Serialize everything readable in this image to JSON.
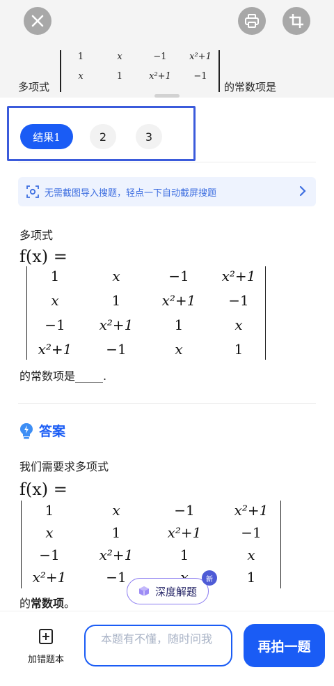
{
  "photo": {
    "left_text": "多项式",
    "right_text": "的常数项是",
    "matrix_rows": [
      [
        "1",
        "x",
        "−1",
        "x²+1"
      ],
      [
        "x",
        "1",
        "x²+1",
        "−1"
      ]
    ]
  },
  "toolbar": {
    "close_icon": "close-icon",
    "print_icon": "printer-icon",
    "crop_icon": "crop-icon"
  },
  "tabs": {
    "items": [
      {
        "label": "结果1",
        "active": true
      },
      {
        "label": "2",
        "active": false
      },
      {
        "label": "3",
        "active": false
      }
    ]
  },
  "banner": {
    "text": "无需截图导入搜题，轻点一下自动截屏搜题"
  },
  "question": {
    "intro": "多项式",
    "fx": "f(x) =",
    "matrix": [
      [
        "1",
        "x",
        "−1",
        "x²+1"
      ],
      [
        "x",
        "1",
        "x²+1",
        "−1"
      ],
      [
        "−1",
        "x²+1",
        "1",
        "x"
      ],
      [
        "x²+1",
        "−1",
        "x",
        "1"
      ]
    ],
    "tail": "的常数项是_____."
  },
  "answer": {
    "title": "答案",
    "intro": "我们需要求多项式",
    "fx": "f(x) =",
    "matrix": [
      [
        "1",
        "x",
        "−1",
        "x²+1"
      ],
      [
        "x",
        "1",
        "x²+1",
        "−1"
      ],
      [
        "−1",
        "x²+1",
        "1",
        "x"
      ],
      [
        "x²+1",
        "−1",
        "x",
        "1"
      ]
    ],
    "tail_prefix": "的",
    "tail_bold": "常数项",
    "tail_suffix": "。"
  },
  "deep_solve": {
    "label": "深度解题",
    "badge": "新"
  },
  "bottom": {
    "add_book_label": "加错题本",
    "ask_placeholder": "本题有不懂，随时问我",
    "retake_label": "再拍一题"
  },
  "colors": {
    "accent": "#1a5cf5",
    "highlight_box": "#3b5bdb",
    "banner_bg": "#eef3fe",
    "banner_text": "#3d6ee0"
  }
}
